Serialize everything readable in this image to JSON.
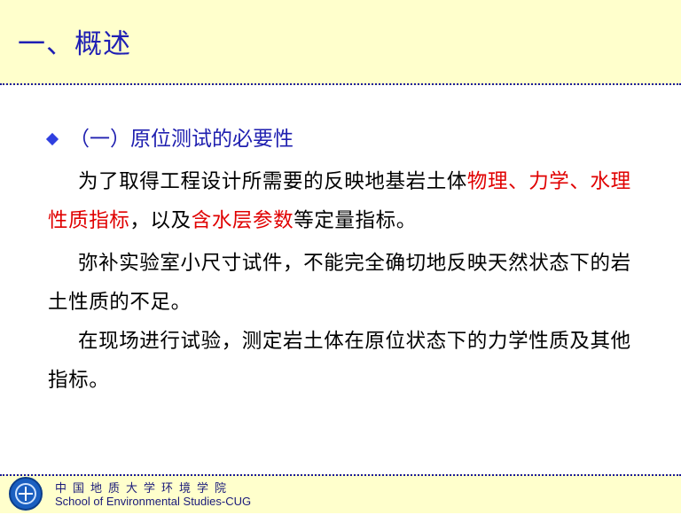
{
  "header": {
    "title": "一、概述"
  },
  "section": {
    "bullet_icon": "diamond-bullet-icon",
    "heading": "（一）原位测试的必要性"
  },
  "paragraphs": {
    "p1": {
      "text_a": "为了取得工程设计所需要的反映地基岩土体",
      "red_a": "物理、力学、水理性质指标",
      "text_b": "，以及",
      "red_b": "含水层参数",
      "text_c": "等定量指标。"
    },
    "p2": "弥补实验室小尺寸试件，不能完全确切地反映天然状态下的岩土性质的不足。",
    "p3": "在现场进行试验，测定岩土体在原位状态下的力学性质及其他指标。"
  },
  "footer": {
    "logo_icon": "university-logo-icon",
    "institution_cn": "中国地质大学环境学院",
    "institution_en": "School of Environmental Studies-CUG"
  },
  "colors": {
    "title": "#1f1fb4",
    "header_bg": "#ffffcc",
    "highlight": "#e00000",
    "bullet": "#2f3fe0"
  }
}
